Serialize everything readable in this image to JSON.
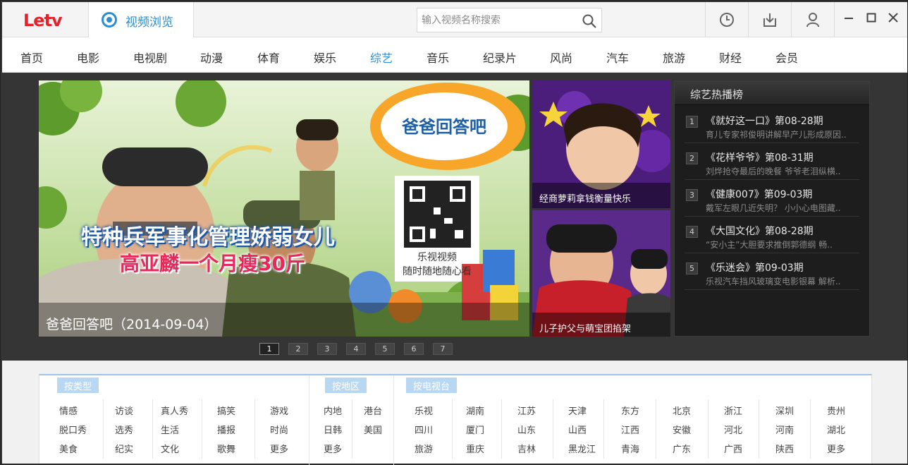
{
  "app": {
    "logo": "Letv"
  },
  "tab": {
    "label": "视频浏览"
  },
  "search": {
    "placeholder": "输入视频名称搜索"
  },
  "nav": [
    "首页",
    "电影",
    "电视剧",
    "动漫",
    "体育",
    "娱乐",
    "综艺",
    "音乐",
    "纪录片",
    "风尚",
    "汽车",
    "旅游",
    "财经",
    "会员"
  ],
  "nav_active_index": 6,
  "banner": {
    "caption": "爸爸回答吧（2014-09-04）",
    "overlay_line1": "特种兵军事化管理娇弱女儿",
    "overlay_line2": "高亚麟一个月瘦30斤",
    "bubble_text": "爸爸回答吧",
    "qr_text1": "乐视视频",
    "qr_text2": "随时随地随心看"
  },
  "side_thumbs": [
    {
      "caption": "经商萝莉拿钱衡量快乐"
    },
    {
      "caption": "儿子护父与萌宝团掐架"
    }
  ],
  "hot": {
    "heading": "综艺热播榜",
    "items": [
      {
        "num": "1",
        "title": "《就好这一口》第08-28期",
        "desc": "育儿专家祁俊明讲解早产儿形成原因.."
      },
      {
        "num": "2",
        "title": "《花样爷爷》第08-31期",
        "desc": "刘烨抢夺最后的晚餐 爷爷老泪纵横.."
      },
      {
        "num": "3",
        "title": "《健康007》第09-03期",
        "desc": "戴军左眼几近失明？ 小小心电图藏.."
      },
      {
        "num": "4",
        "title": "《大国文化》第08-28期",
        "desc": "“安小主”大胆要求推倒郭德纲 畅.."
      },
      {
        "num": "5",
        "title": "《乐迷会》第09-03期",
        "desc": "乐视汽车挡风玻璃变电影银幕 解析.."
      }
    ]
  },
  "pager": [
    "1",
    "2",
    "3",
    "4",
    "5",
    "6",
    "7"
  ],
  "pager_active_index": 0,
  "categories": {
    "by_type": {
      "label": "按类型",
      "rows": [
        [
          "情感",
          "访谈",
          "真人秀",
          "搞笑",
          "游戏"
        ],
        [
          "脱口秀",
          "选秀",
          "生活",
          "播报",
          "时尚"
        ],
        [
          "美食",
          "纪实",
          "文化",
          "歌舞",
          "更多"
        ]
      ]
    },
    "by_region": {
      "label": "按地区",
      "rows": [
        [
          "内地",
          "港台"
        ],
        [
          "日韩",
          "美国"
        ],
        [
          "更多",
          ""
        ]
      ]
    },
    "by_station": {
      "label": "按电视台",
      "rows": [
        [
          "乐视",
          "湖南",
          "江苏",
          "天津",
          "东方",
          "北京",
          "浙江",
          "深圳",
          "贵州"
        ],
        [
          "四川",
          "厦门",
          "山东",
          "山西",
          "江西",
          "安徽",
          "河北",
          "河南",
          "湖北"
        ],
        [
          "旅游",
          "重庆",
          "吉林",
          "黑龙江",
          "青海",
          "广东",
          "广西",
          "陕西",
          "更多"
        ]
      ]
    }
  },
  "colors": {
    "accent": "#2a8ed6",
    "brand": "#e6212a"
  }
}
